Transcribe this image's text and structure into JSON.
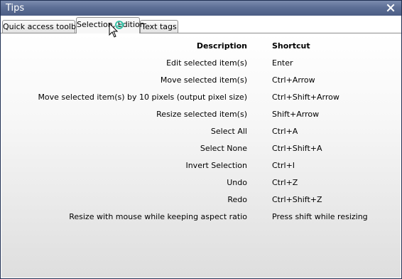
{
  "window": {
    "title": "Tips"
  },
  "tabs": [
    {
      "label": "Quick access toolbar",
      "active": false
    },
    {
      "label": "Selection, Edition",
      "active": true
    },
    {
      "label": "Text tags",
      "active": false
    }
  ],
  "table": {
    "headers": {
      "description": "Description",
      "shortcut": "Shortcut"
    },
    "rows": [
      {
        "description": "Edit selected item(s)",
        "shortcut": "Enter"
      },
      {
        "description": "Move selected item(s)",
        "shortcut": "Ctrl+Arrow"
      },
      {
        "description": "Move selected item(s) by 10 pixels (output pixel size)",
        "shortcut": "Ctrl+Shift+Arrow"
      },
      {
        "description": "Resize selected item(s)",
        "shortcut": "Shift+Arrow"
      },
      {
        "description": "Select All",
        "shortcut": "Ctrl+A"
      },
      {
        "description": "Select None",
        "shortcut": "Ctrl+Shift+A"
      },
      {
        "description": "Invert Selection",
        "shortcut": "Ctrl+I"
      },
      {
        "description": "Undo",
        "shortcut": "Ctrl+Z"
      },
      {
        "description": "Redo",
        "shortcut": "Ctrl+Shift+Z"
      },
      {
        "description": "Resize with mouse while keeping aspect ratio",
        "shortcut": "Press shift while resizing"
      }
    ]
  },
  "icons": {
    "close": "close-icon",
    "cursor": "mouse-pointer-icon"
  },
  "colors": {
    "titlebar": "#5d6f96",
    "titlebar_text": "#ffffff",
    "tab_border": "#8e8e8e",
    "content_bottom": "#dedede"
  }
}
